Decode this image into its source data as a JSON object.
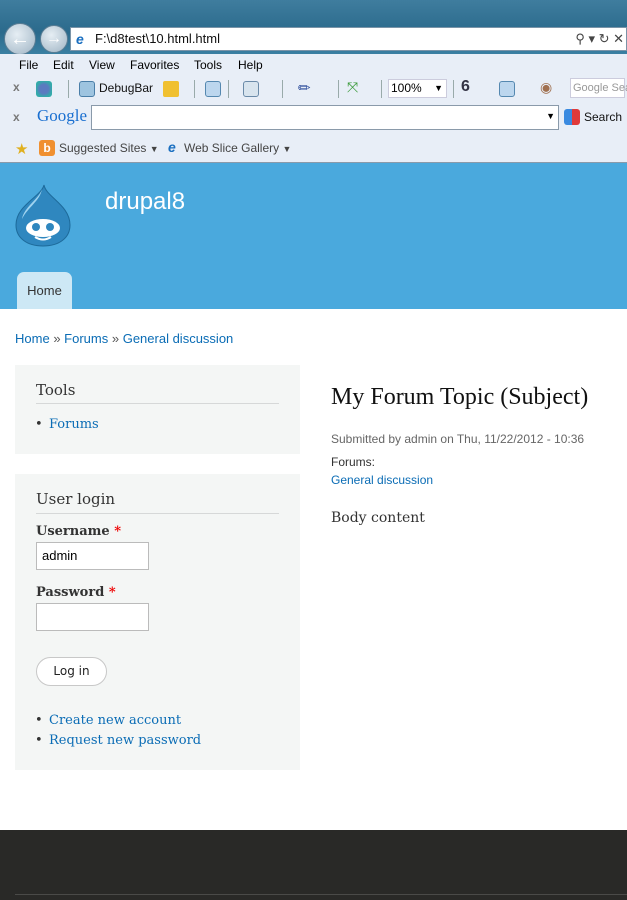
{
  "browser": {
    "address": "F:\\d8test\\10.html.html",
    "menu": [
      "File",
      "Edit",
      "View",
      "Favorites",
      "Tools",
      "Help"
    ],
    "toolbar": {
      "debugbar": "DebugBar",
      "zoom": "100%",
      "google_search_placeholder": "Google Sea"
    },
    "google_bar": {
      "logo": "Google",
      "search_label": "Search"
    },
    "favorites": {
      "suggested": "Suggested Sites",
      "webslice": "Web Slice Gallery"
    }
  },
  "site": {
    "name": "drupal8",
    "nav": [
      "Home"
    ]
  },
  "breadcrumb": [
    "Home",
    "Forums",
    "General discussion"
  ],
  "breadcrumb_sep": "»",
  "sidebar": {
    "tools": {
      "title": "Tools",
      "items": [
        "Forums"
      ]
    },
    "login": {
      "title": "User login",
      "username_label": "Username",
      "password_label": "Password",
      "required": "*",
      "username_value": "admin",
      "submit": "Log in",
      "links": [
        "Create new account",
        "Request new password"
      ]
    }
  },
  "content": {
    "title": "My Forum Topic (Subject)",
    "submitted": "Submitted by admin on Thu, 11/22/2012 - 10:36",
    "forums_label": "Forums:",
    "forum": "General discussion",
    "body": "Body content"
  }
}
